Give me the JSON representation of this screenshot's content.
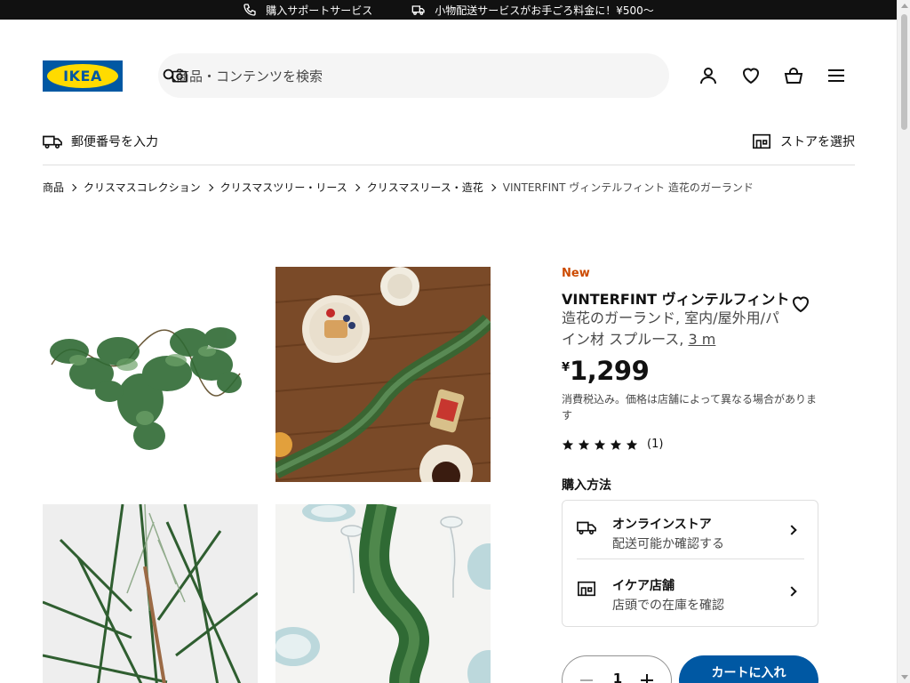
{
  "topbar": {
    "promo1": "購入サポートサービス",
    "promo2": "小物配送サービスがお手ごろ料金に！¥500〜"
  },
  "header": {
    "logo_text": "IKEA",
    "search_placeholder": "商品・コンテンツを検索",
    "icons": [
      "user-icon",
      "heart-icon",
      "cart-icon",
      "menu-icon"
    ]
  },
  "location": {
    "postal": "郵便番号を入力",
    "store": "ストアを選択"
  },
  "breadcrumb": [
    "商品",
    "クリスマスコレクション",
    "クリスマスツリー・リース",
    "クリスマスリース・造花",
    "VINTERFINT ヴィンテルフィント 造花のガーランド"
  ],
  "product": {
    "badge": "New",
    "name": "VINTERFINT ヴィンテルフィント",
    "description": "造花のガーランド, 室内/屋外用/パイン材 スプルース,",
    "size": "3 m",
    "currency": "¥",
    "price": "1,299",
    "tax_note": "消費税込み。価格は店舗によって異なる場合があります",
    "rating_stars": 5,
    "rating_count": "(1)"
  },
  "purchase": {
    "heading": "購入方法",
    "online_title": "オンラインストア",
    "online_sub": "配送可能か確認する",
    "store_title": "イケア店舗",
    "store_sub": "店頭での在庫を確認",
    "qty": "1",
    "add_to_cart": "カートに入れ"
  },
  "colors": {
    "brand_blue": "#0058a3",
    "brand_yellow": "#ffdb00",
    "new_badge": "#cc4a00"
  }
}
